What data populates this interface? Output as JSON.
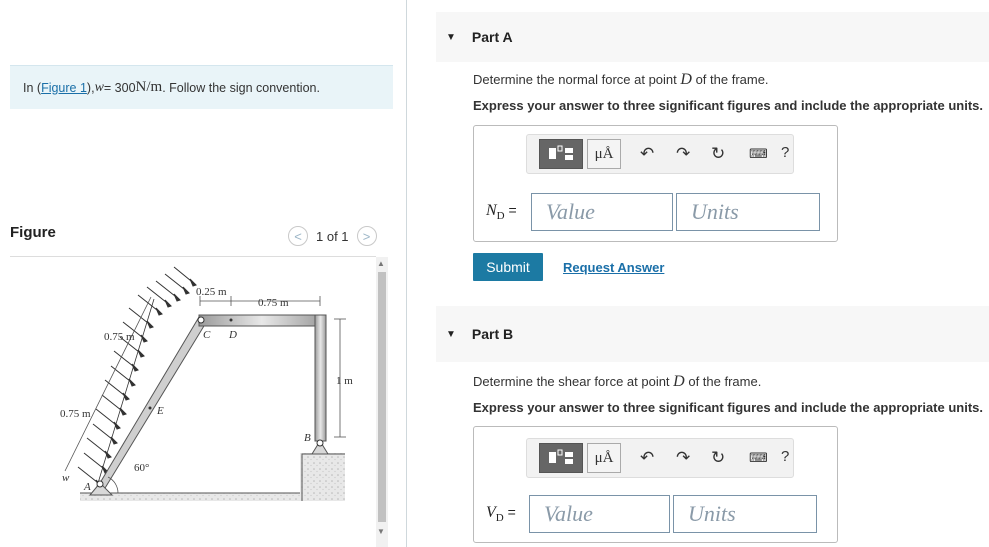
{
  "problem": {
    "intro_prefix": "In (",
    "figure_link": "Figure 1",
    "intro_mid": "), ",
    "w_var": "w",
    "equals": " = 300 ",
    "unit": "N/m",
    "intro_suffix": ". Follow the sign convention."
  },
  "figure": {
    "heading": "Figure",
    "page_indicator": "1 of 1",
    "prev_symbol": "<",
    "next_symbol": ">",
    "labels": {
      "dim_025": "0.25 m",
      "dim_075_top": "0.75 m",
      "dim_075_slant_upper": "0.75 m",
      "dim_075_slant_lower": "0.75 m",
      "dim_1m": "1 m",
      "pt_C": "C",
      "pt_D": "D",
      "pt_E": "E",
      "pt_B": "B",
      "pt_A": "A",
      "load_w": "w",
      "angle": "60°"
    }
  },
  "partA": {
    "title": "Part A",
    "question_prefix": "Determine the normal force at point ",
    "question_var": "D",
    "question_suffix": " of the frame.",
    "instruction": "Express your answer to three significant figures and include the appropriate units.",
    "eq_var": "N",
    "eq_sub": "D",
    "eq_sign": " =",
    "value_placeholder": "Value",
    "units_placeholder": "Units",
    "mu_label": "μÅ",
    "help": "?",
    "submit": "Submit",
    "request": "Request Answer"
  },
  "partB": {
    "title": "Part B",
    "question_prefix": "Determine the shear force at point ",
    "question_var": "D",
    "question_suffix": " of the frame.",
    "instruction": "Express your answer to three significant figures and include the appropriate units.",
    "eq_var": "V",
    "eq_sub": "D",
    "eq_sign": " =",
    "value_placeholder": "Value",
    "units_placeholder": "Units",
    "mu_label": "μÅ",
    "help": "?"
  },
  "icons": {
    "collapse": "caret-down-icon",
    "undo": "undo-icon",
    "redo": "redo-icon",
    "reset": "reset-icon",
    "keyboard": "keyboard-icon",
    "help": "help-icon",
    "templates": "fraction-template-icon"
  }
}
